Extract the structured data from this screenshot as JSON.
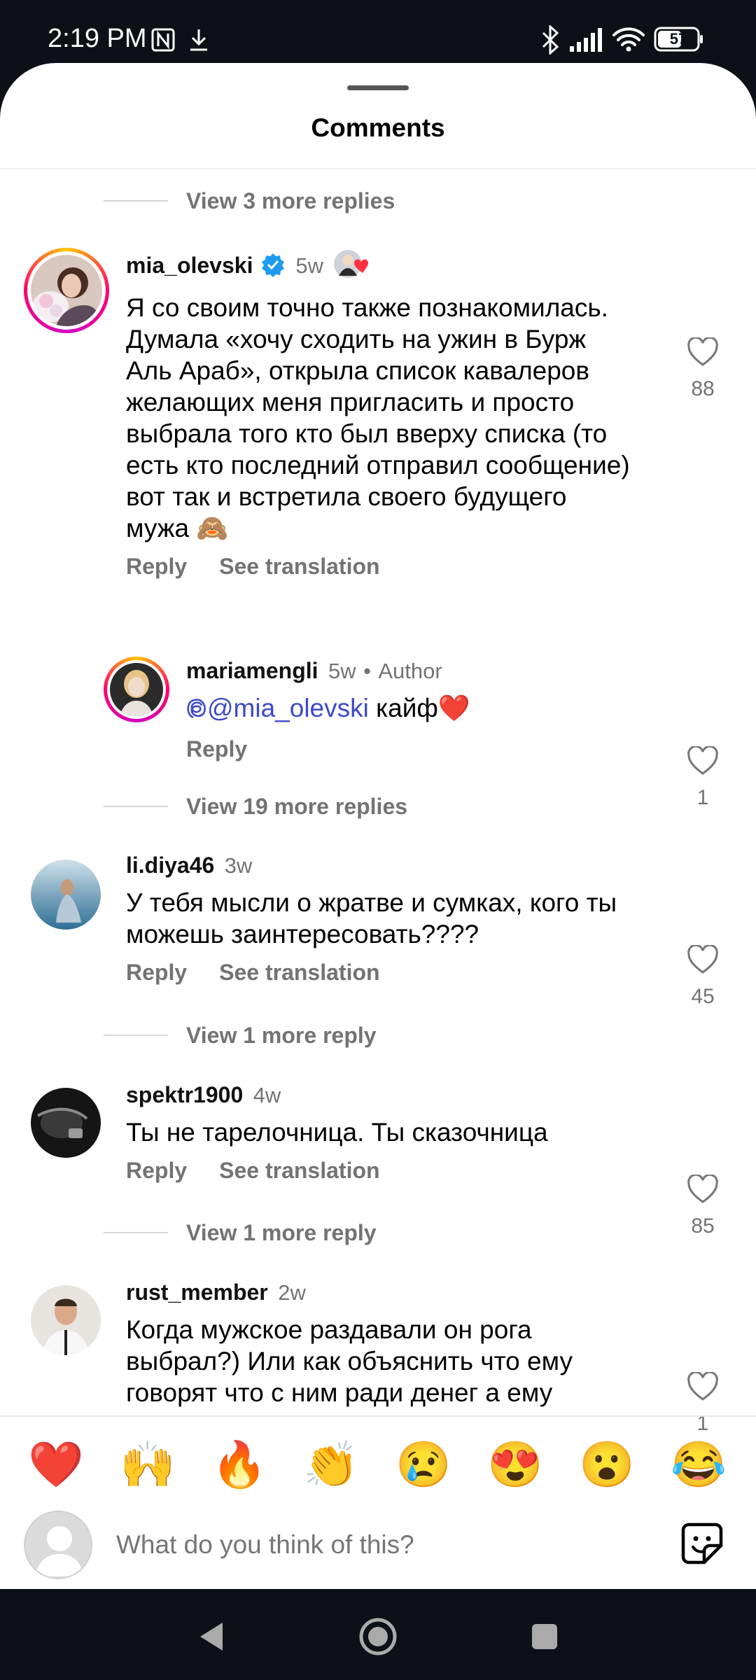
{
  "status_bar": {
    "time": "2:19 PM",
    "battery": "57"
  },
  "sheet": {
    "title": "Comments"
  },
  "view_more_1": "View 3 more replies",
  "comments": [
    {
      "username": "mia_olevski",
      "time": "5w",
      "text": "Я со своим точно также познакомилась. Думала «хочу сходить на ужин в Бурж Аль Араб», открыла список кавалеров желающих меня пригласить и просто выбрала того кто был вверху списка (то есть кто последний отправил сообщение) вот так и встретила своего будущего мужа 🙈",
      "likes": "88",
      "reply": "Reply",
      "translate": "See translation"
    },
    {
      "username": "mariamengli",
      "time": "5w",
      "badge": "Author",
      "mention": "@mia_olevski",
      "text": " кайф❤️",
      "likes": "1",
      "reply": "Reply"
    },
    {
      "username": "li.diya46",
      "time": "3w",
      "text": "У тебя  мысли о жратве и сумках, кого ты можешь заинтересовать????",
      "likes": "45",
      "reply": "Reply",
      "translate": "See translation"
    },
    {
      "username": "spektr1900",
      "time": "4w",
      "text": "Ты не тарелочница. Ты сказочница",
      "likes": "85",
      "reply": "Reply",
      "translate": "See translation"
    },
    {
      "username": "rust_member",
      "time": "2w",
      "text": "Когда мужское раздавали он рога выбрал?) Или как объяснить что ему говорят что с ним ради денег а ему",
      "likes": "1"
    }
  ],
  "view_more_2": "View 19 more replies",
  "view_more_3": "View 1 more reply",
  "view_more_4": "View 1 more reply",
  "emojis": [
    "❤️",
    "🙌",
    "🔥",
    "👏",
    "😢",
    "😍",
    "😮",
    "😂"
  ],
  "input": {
    "placeholder": "What do you think of this?"
  }
}
